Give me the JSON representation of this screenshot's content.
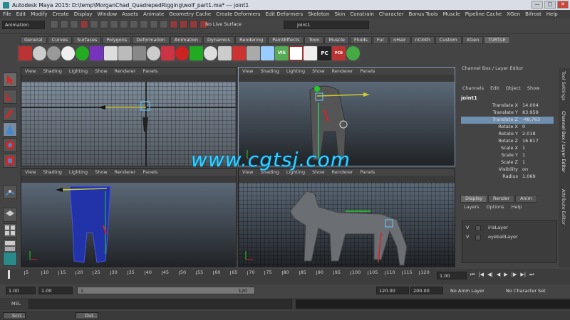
{
  "window": {
    "title": "Autodesk Maya 2015: D:\\temp\\MorganChad_QuadrepedRigging\\wolf_part1.ma*  ---  joint1",
    "buttons": [
      "—",
      "□",
      "✕"
    ]
  },
  "menubar": [
    "File",
    "Edit",
    "Modify",
    "Create",
    "Display",
    "Window",
    "Assets",
    "Animate",
    "Geometry Cache",
    "Create Deformers",
    "Edit Deformers",
    "Skeleton",
    "Skin",
    "Constrain",
    "Character",
    "Bonus Tools",
    "Muscle",
    "Pipeline Cache",
    "XGen",
    "Bifrost",
    "Help"
  ],
  "status": {
    "mode": "Animation",
    "live_surface": "No Live Surface",
    "selected_object": "joint1"
  },
  "shelf": {
    "tabs": [
      "General",
      "Curves",
      "Surfaces",
      "Polygons",
      "Deformation",
      "Animation",
      "Dynamics",
      "Rendering",
      "PaintEffects",
      "Toon",
      "Muscle",
      "Fluids",
      "Fur",
      "nHair",
      "nCloth",
      "Custom",
      "XGen",
      "TURTLE"
    ],
    "active_tab": "TURTLE",
    "labels": [
      "HW",
      "VIS",
      "PC",
      "PCB"
    ]
  },
  "viewports": {
    "menu": [
      "View",
      "Shading",
      "Lighting",
      "Show",
      "Renderer",
      "Panels"
    ]
  },
  "channel_box": {
    "title": "Channel Box / Layer Editor",
    "menu": [
      "Channels",
      "Edit",
      "Object",
      "Show"
    ],
    "object": "joint1",
    "attributes": [
      {
        "label": "Translate X",
        "value": "14.004"
      },
      {
        "label": "Translate Y",
        "value": "83.959"
      },
      {
        "label": "Translate Z",
        "value": "-48.763"
      },
      {
        "label": "Rotate X",
        "value": "0"
      },
      {
        "label": "Rotate Y",
        "value": "2.018"
      },
      {
        "label": "Rotate Z",
        "value": "16.817"
      },
      {
        "label": "Scale X",
        "value": "1"
      },
      {
        "label": "Scale Y",
        "value": "1"
      },
      {
        "label": "Scale Z",
        "value": "1"
      },
      {
        "label": "Visibility",
        "value": "on"
      },
      {
        "label": "Radius",
        "value": "1.069"
      }
    ],
    "selected_index": 2
  },
  "side_tabs": [
    "Tool Settings",
    "Channel Box / Layer Editor",
    "Attribute Editor"
  ],
  "layer_editor": {
    "tabs": [
      "Display",
      "Render",
      "Anim"
    ],
    "active_tab": "Display",
    "menu": [
      "Layers",
      "Options",
      "Help"
    ],
    "layers": [
      {
        "visible": "V",
        "name": "irisLayer"
      },
      {
        "visible": "V",
        "name": "eyeballLayer"
      }
    ]
  },
  "timeline": {
    "ticks": [
      "5",
      "10",
      "15",
      "20",
      "25",
      "30",
      "35",
      "40",
      "45",
      "50",
      "55",
      "60",
      "65",
      "70",
      "75",
      "80",
      "85",
      "90",
      "95",
      "100",
      "105",
      "110",
      "115",
      "120"
    ],
    "current_frame": "1.00",
    "current_marker": "1"
  },
  "range": {
    "start": "1.00",
    "playback_start": "1.00",
    "slider_start": "1",
    "slider_end": "120",
    "playback_end": "120.00",
    "end": "200.00",
    "anim_layer": "No Anim Layer",
    "character_set": "No Character Set"
  },
  "command_line": {
    "label": "MEL"
  },
  "taskbar": [
    "Scri...",
    "Out..."
  ],
  "watermark": "www.cgtsj.com"
}
